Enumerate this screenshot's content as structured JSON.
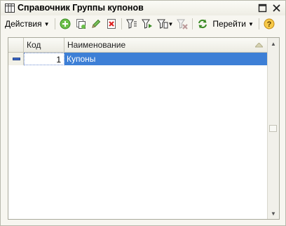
{
  "window": {
    "title": "Справочник Группы купонов",
    "title_icon": "table-icon",
    "controls": [
      "maximize-icon",
      "close-icon"
    ]
  },
  "toolbar": {
    "actions_label": "Действия",
    "goto_label": "Перейти",
    "buttons": [
      "add-icon",
      "copy-icon",
      "edit-icon",
      "delete-icon",
      "filter-set-icon",
      "filter-by-value-icon",
      "filter-history-icon",
      "filter-clear-icon",
      "refresh-icon",
      "help-icon"
    ]
  },
  "table": {
    "columns": [
      "Код",
      "Наименование"
    ],
    "rows": [
      {
        "code": "1",
        "name": "Купоны",
        "selected": true
      }
    ]
  },
  "colors": {
    "selection": "#3d7fd6",
    "row_marker": "#3a66c4",
    "window_bg": "#f7f6f0"
  }
}
